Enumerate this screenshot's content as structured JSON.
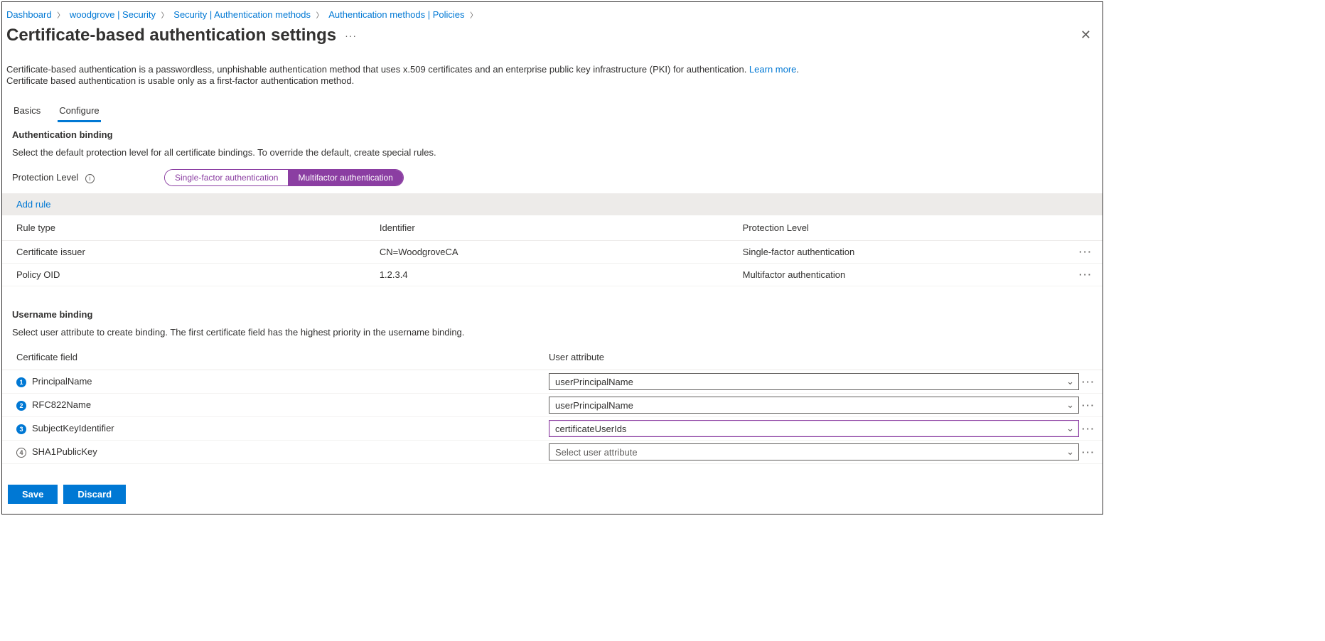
{
  "breadcrumb": [
    "Dashboard",
    "woodgrove | Security",
    "Security | Authentication methods",
    "Authentication methods | Policies"
  ],
  "page_title": "Certificate-based authentication settings",
  "description_line1_pre": "Certificate-based authentication is a passwordless, unphishable authentication method that uses x.509 certificates and an enterprise public key infrastructure (PKI) for authentication. ",
  "learn_more": "Learn more",
  "description_line2": "Certificate based authentication is usable only as a first-factor authentication method.",
  "tabs": {
    "basics": "Basics",
    "configure": "Configure"
  },
  "auth_binding": {
    "title": "Authentication binding",
    "desc": "Select the default protection level for all certificate bindings. To override the default, create special rules.",
    "level_label": "Protection Level",
    "single": "Single-factor authentication",
    "multi": "Multifactor authentication",
    "add_rule": "Add rule",
    "headers": {
      "type": "Rule type",
      "id": "Identifier",
      "level": "Protection Level"
    },
    "rows": [
      {
        "type": "Certificate issuer",
        "id": "CN=WoodgroveCA",
        "level": "Single-factor authentication"
      },
      {
        "type": "Policy OID",
        "id": "1.2.3.4",
        "level": "Multifactor authentication"
      }
    ]
  },
  "user_binding": {
    "title": "Username binding",
    "desc": "Select user attribute to create binding. The first certificate field has the highest priority in the username binding.",
    "headers": {
      "cert": "Certificate field",
      "attr": "User attribute"
    },
    "placeholder": "Select user attribute",
    "rows": [
      {
        "ord": "1",
        "cert": "PrincipalName",
        "attr": "userPrincipalName",
        "active": true,
        "hl": false
      },
      {
        "ord": "2",
        "cert": "RFC822Name",
        "attr": "userPrincipalName",
        "active": true,
        "hl": false
      },
      {
        "ord": "3",
        "cert": "SubjectKeyIdentifier",
        "attr": "certificateUserIds",
        "active": true,
        "hl": true
      },
      {
        "ord": "4",
        "cert": "SHA1PublicKey",
        "attr": "",
        "active": false,
        "hl": false
      }
    ]
  },
  "footer": {
    "save": "Save",
    "discard": "Discard"
  }
}
